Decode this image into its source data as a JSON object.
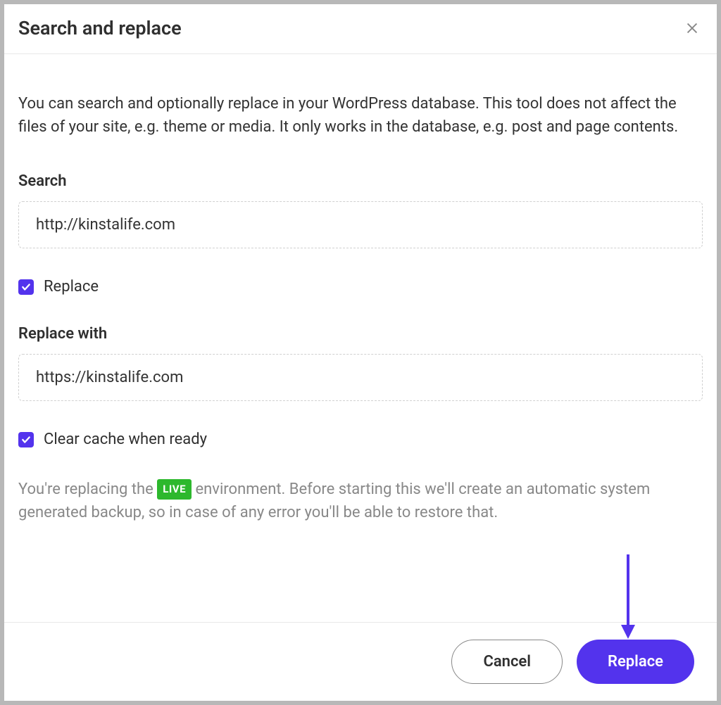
{
  "header": {
    "title": "Search and replace"
  },
  "body": {
    "description": "You can search and optionally replace in your WordPress database. This tool does not affect the files of your site, e.g. theme or media. It only works in the database, e.g. post and page contents.",
    "search_label": "Search",
    "search_value": "http://kinstalife.com",
    "replace_checkbox_label": "Replace",
    "replace_checkbox_checked": true,
    "replace_with_label": "Replace with",
    "replace_with_value": "https://kinstalife.com",
    "clear_cache_label": "Clear cache when ready",
    "clear_cache_checked": true,
    "warning_prefix": "You're replacing the ",
    "live_badge": "LIVE",
    "warning_suffix": " environment. Before starting this we'll create an automatic system generated backup, so in case of any error you'll be able to restore that."
  },
  "footer": {
    "cancel_label": "Cancel",
    "replace_label": "Replace"
  },
  "colors": {
    "primary": "#5333ed",
    "live_badge": "#2db82d"
  }
}
